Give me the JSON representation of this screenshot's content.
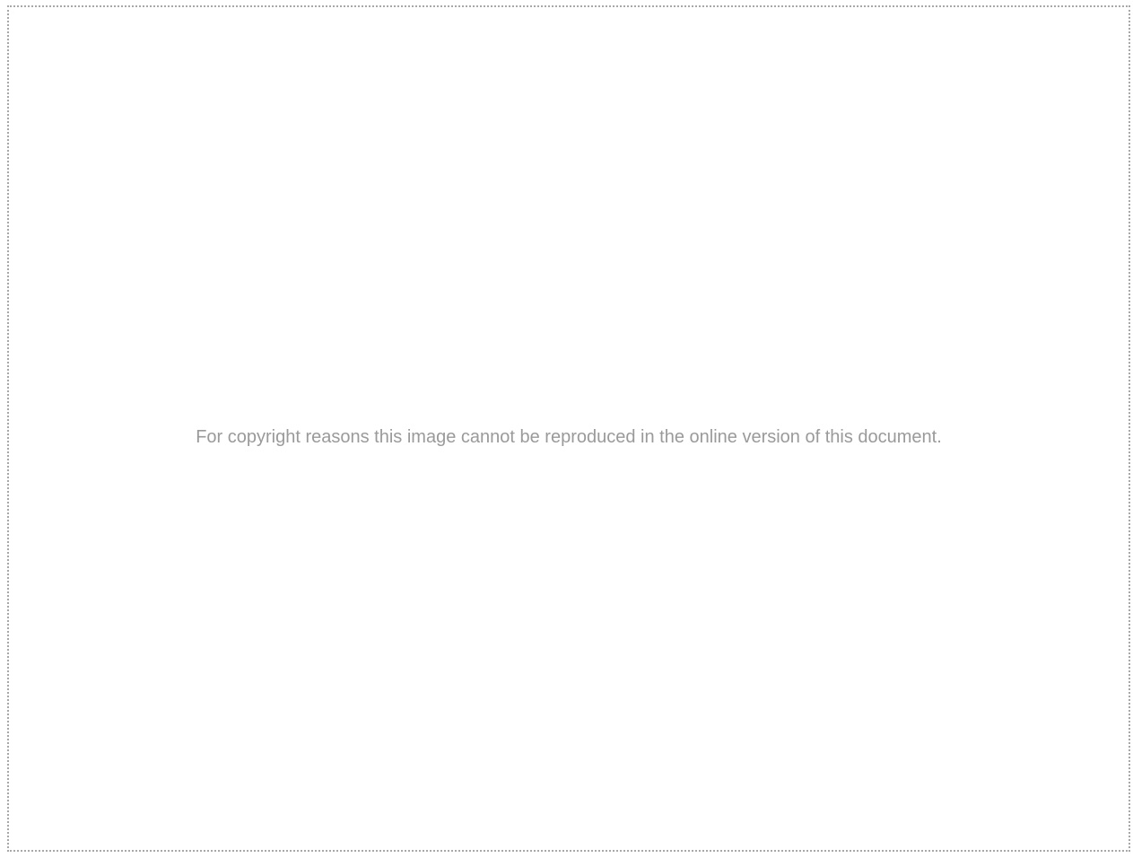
{
  "notice": {
    "text": "For copyright reasons this image cannot be reproduced in the online version of this document."
  },
  "colors": {
    "text": "#9a9a9a",
    "border": "#a8a8a8",
    "background": "#ffffff"
  }
}
